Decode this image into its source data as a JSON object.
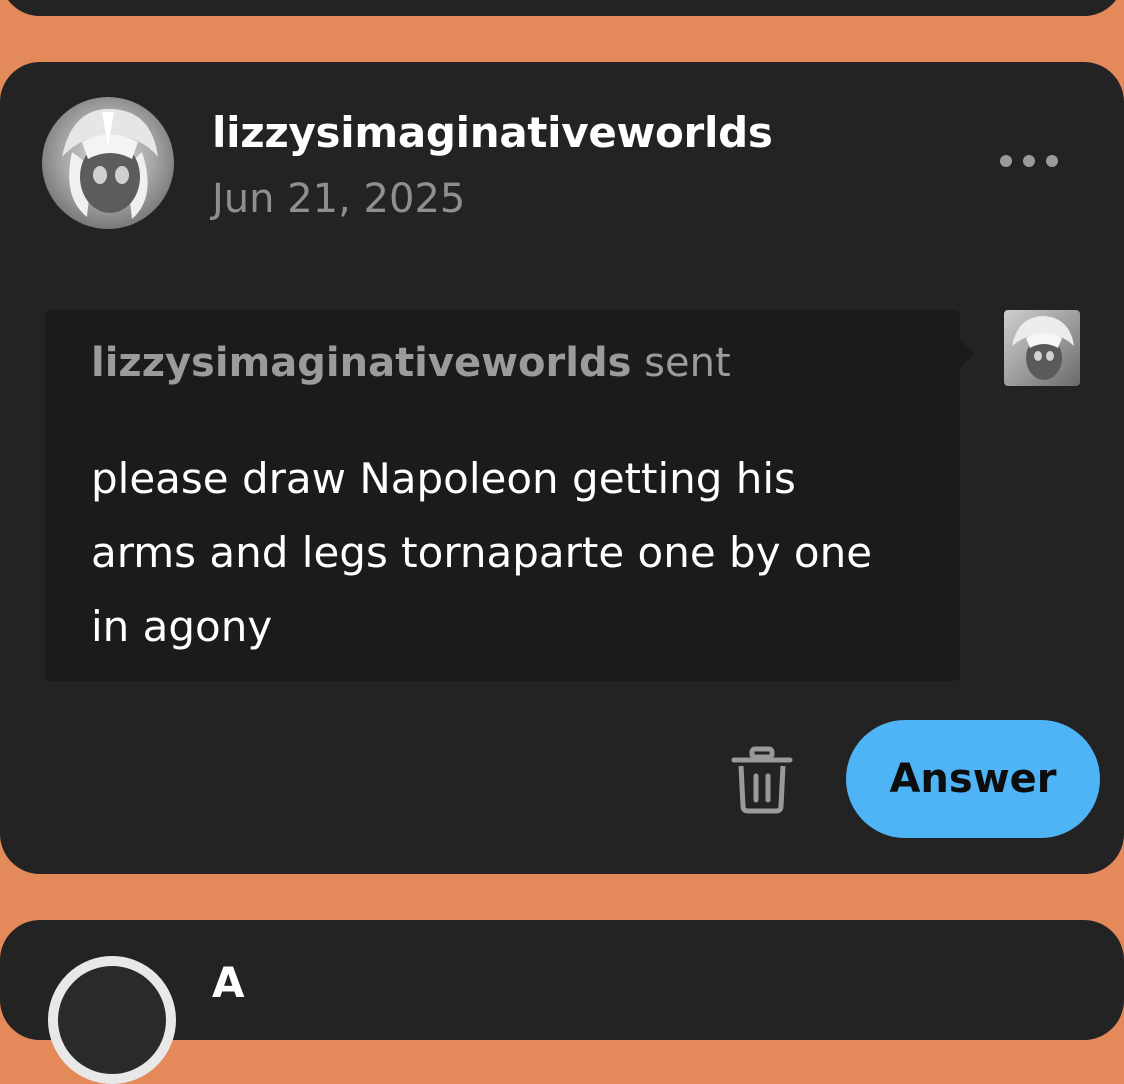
{
  "post": {
    "username": "lizzysimaginativeworlds",
    "date": "Jun 21, 2025",
    "more_icon": "more-horizontal-icon"
  },
  "ask": {
    "sender_name": "lizzysimaginativeworlds",
    "sender_verb": "sent",
    "message": "please draw Napoleon getting his arms and legs tornaparte one by one in agony"
  },
  "actions": {
    "delete_icon": "trash-icon",
    "answer_label": "Answer"
  },
  "next_post": {
    "username_partial": "A"
  },
  "colors": {
    "background": "#e4895a",
    "card": "#232323",
    "bubble": "#1b1b1b",
    "answer_button": "#4fb4f5",
    "muted_text": "#8f8f8f"
  }
}
